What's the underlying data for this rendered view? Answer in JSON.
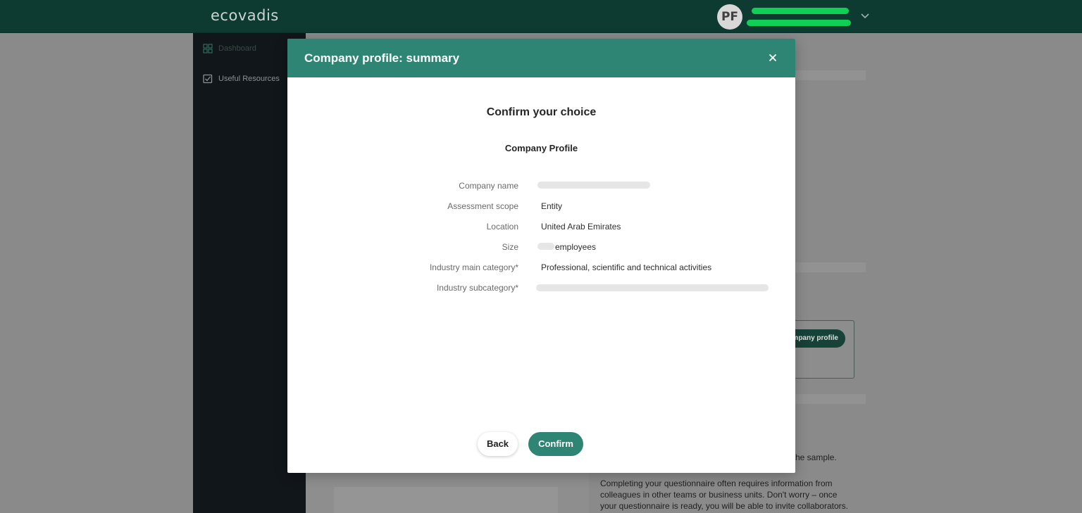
{
  "app": {
    "logo": "ecovadis"
  },
  "user": {
    "initials": "PF"
  },
  "sidebar": {
    "items": [
      {
        "label": "Dashboard",
        "icon": "grid-icon"
      },
      {
        "label": "Useful Resources",
        "icon": "checkbox-icon"
      }
    ]
  },
  "background": {
    "card_button": "mpany profile",
    "text_sample": "he sample.",
    "text_paragraph": [
      "Completing your questionnaire often requires information from",
      "colleagues in other teams or business units. Don't worry – once",
      "your questionnaire is ready, you will be able to invite collaborators."
    ]
  },
  "modal": {
    "title": "Company profile: summary",
    "heading": "Confirm your choice",
    "subheading": "Company Profile",
    "fields": [
      {
        "label": "Company name",
        "value": ""
      },
      {
        "label": "Assessment scope",
        "value": "Entity"
      },
      {
        "label": "Location",
        "value": "United Arab Emirates"
      },
      {
        "label": "Size",
        "value": "employees"
      },
      {
        "label": "Industry main category*",
        "value": "Professional, scientific and technical activities"
      },
      {
        "label": "Industry subcategory*",
        "value": ""
      }
    ],
    "back_label": "Back",
    "confirm_label": "Confirm"
  },
  "colors": {
    "topbar": "#0d3a31",
    "accent": "#2f8573",
    "redaction_green": "#0fcf55"
  }
}
